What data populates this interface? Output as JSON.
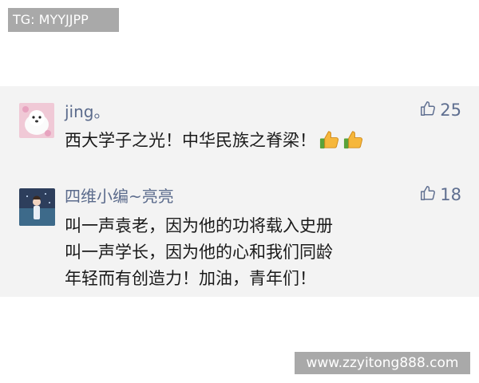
{
  "watermark_top": "TG: MYYJJPP",
  "watermark_bottom": "www.zzyitong888.com",
  "comments": [
    {
      "username": "jing。",
      "likes": "25",
      "lines": [
        "西大学子之光！中华民族之脊梁！"
      ],
      "emoji": [
        "thumbs-up-emoji",
        "thumbs-up-emoji"
      ]
    },
    {
      "username": "四维小编~亮亮",
      "likes": "18",
      "lines": [
        "叫一声袁老，因为他的功将载入史册",
        "叫一声学长，因为他的心和我们同龄",
        "年轻而有创造力！加油，青年们！"
      ]
    }
  ],
  "colors": {
    "panel_bg": "#f3f3f3",
    "username": "#5b6b8c",
    "like_count": "#5f6f90",
    "watermark_bg": "#a9a9a9"
  },
  "icons": [
    "thumbs-up-outline-icon",
    "dog-avatar",
    "anime-avatar",
    "thumbs-up-emoji"
  ]
}
